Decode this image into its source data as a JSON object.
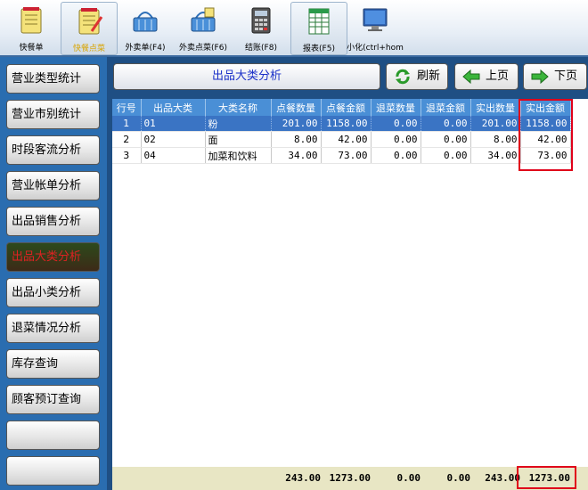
{
  "toolbar": {
    "buttons": [
      {
        "label": "快餐单",
        "icon": "notepad-icon"
      },
      {
        "label": "快餐点菜",
        "icon": "notepad-pen-icon"
      },
      {
        "label": "外卖单(F4)",
        "icon": "basket-icon"
      },
      {
        "label": "外卖点菜(F6)",
        "icon": "basket-icon"
      },
      {
        "label": "结账(F8)",
        "icon": "calculator-icon"
      },
      {
        "label": "报表(F5)",
        "icon": "spreadsheet-icon"
      },
      {
        "label": "小化(ctrl+hom",
        "icon": "monitor-icon"
      }
    ]
  },
  "nav": {
    "items": [
      {
        "label": "营业类型统计"
      },
      {
        "label": "营业市别统计"
      },
      {
        "label": "时段客流分析"
      },
      {
        "label": "营业帐单分析"
      },
      {
        "label": "出品销售分析"
      },
      {
        "label": "出品大类分析"
      },
      {
        "label": "出品小类分析"
      },
      {
        "label": "退菜情况分析"
      },
      {
        "label": "库存查询"
      },
      {
        "label": "顾客预订查询"
      },
      {
        "label": ""
      },
      {
        "label": ""
      }
    ]
  },
  "main": {
    "title": "出品大类分析",
    "refresh_label": "刷新",
    "prev_label": "上页",
    "next_label": "下页"
  },
  "table": {
    "columns": [
      "行号",
      "出品大类",
      "大类名称",
      "点餐数量",
      "点餐金额",
      "退菜数量",
      "退菜金额",
      "实出数量",
      "实出金额"
    ],
    "rows": [
      [
        "1",
        "01",
        "粉",
        "201.00",
        "1158.00",
        "0.00",
        "0.00",
        "201.00",
        "1158.00"
      ],
      [
        "2",
        "02",
        "面",
        "8.00",
        "42.00",
        "0.00",
        "0.00",
        "8.00",
        "42.00"
      ],
      [
        "3",
        "04",
        "加菜和饮料",
        "34.00",
        "73.00",
        "0.00",
        "0.00",
        "34.00",
        "73.00"
      ]
    ],
    "totals": [
      "243.00",
      "1273.00",
      "0.00",
      "0.00",
      "243.00",
      "1273.00"
    ]
  },
  "colors": {
    "header_blue": "#4a8fd6",
    "selected_row": "#3a74c4",
    "highlight_red": "#e0001a",
    "totals_bg": "#e8e6c4"
  }
}
